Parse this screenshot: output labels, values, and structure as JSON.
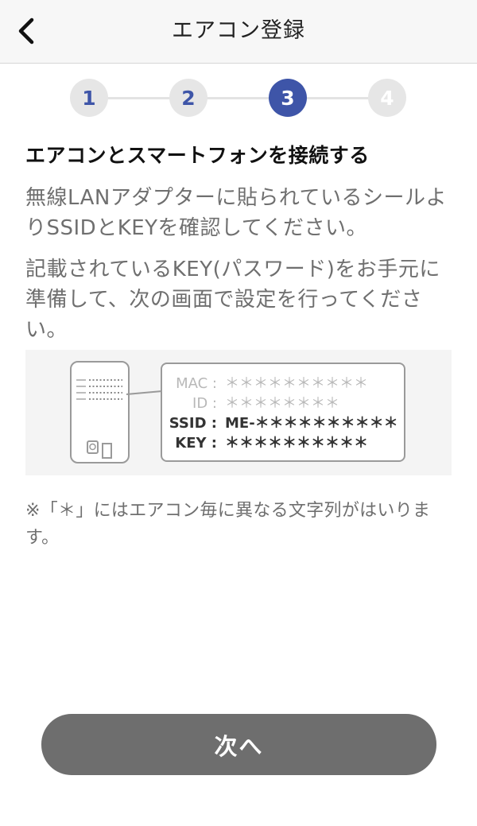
{
  "header": {
    "title": "エアコン登録",
    "back_icon": "chevron-left-icon"
  },
  "stepper": {
    "steps": [
      "1",
      "2",
      "3",
      "4"
    ],
    "current_step": 3,
    "active_color": "#3e55a8"
  },
  "content": {
    "heading": "エアコンとスマートフォンを接続する",
    "paragraph1": "無線LANアダプターに貼られているシールよりSSIDとKEYを確認してください。",
    "paragraph2": "記載されているKEY(パスワード)をお手元に準備して、次の画面で設定を行ってください。",
    "label": {
      "mac": "MAC：＊＊＊＊＊＊＊＊＊＊",
      "id": "ID：＊＊＊＊＊＊＊＊",
      "ssid": "SSID：ME-＊＊＊＊＊＊＊＊＊＊",
      "key": "KEY：＊＊＊＊＊＊＊＊＊＊"
    },
    "note": "※「＊」にはエアコン毎に異なる文字列がはいります。"
  },
  "footer": {
    "next_label": "次へ"
  }
}
